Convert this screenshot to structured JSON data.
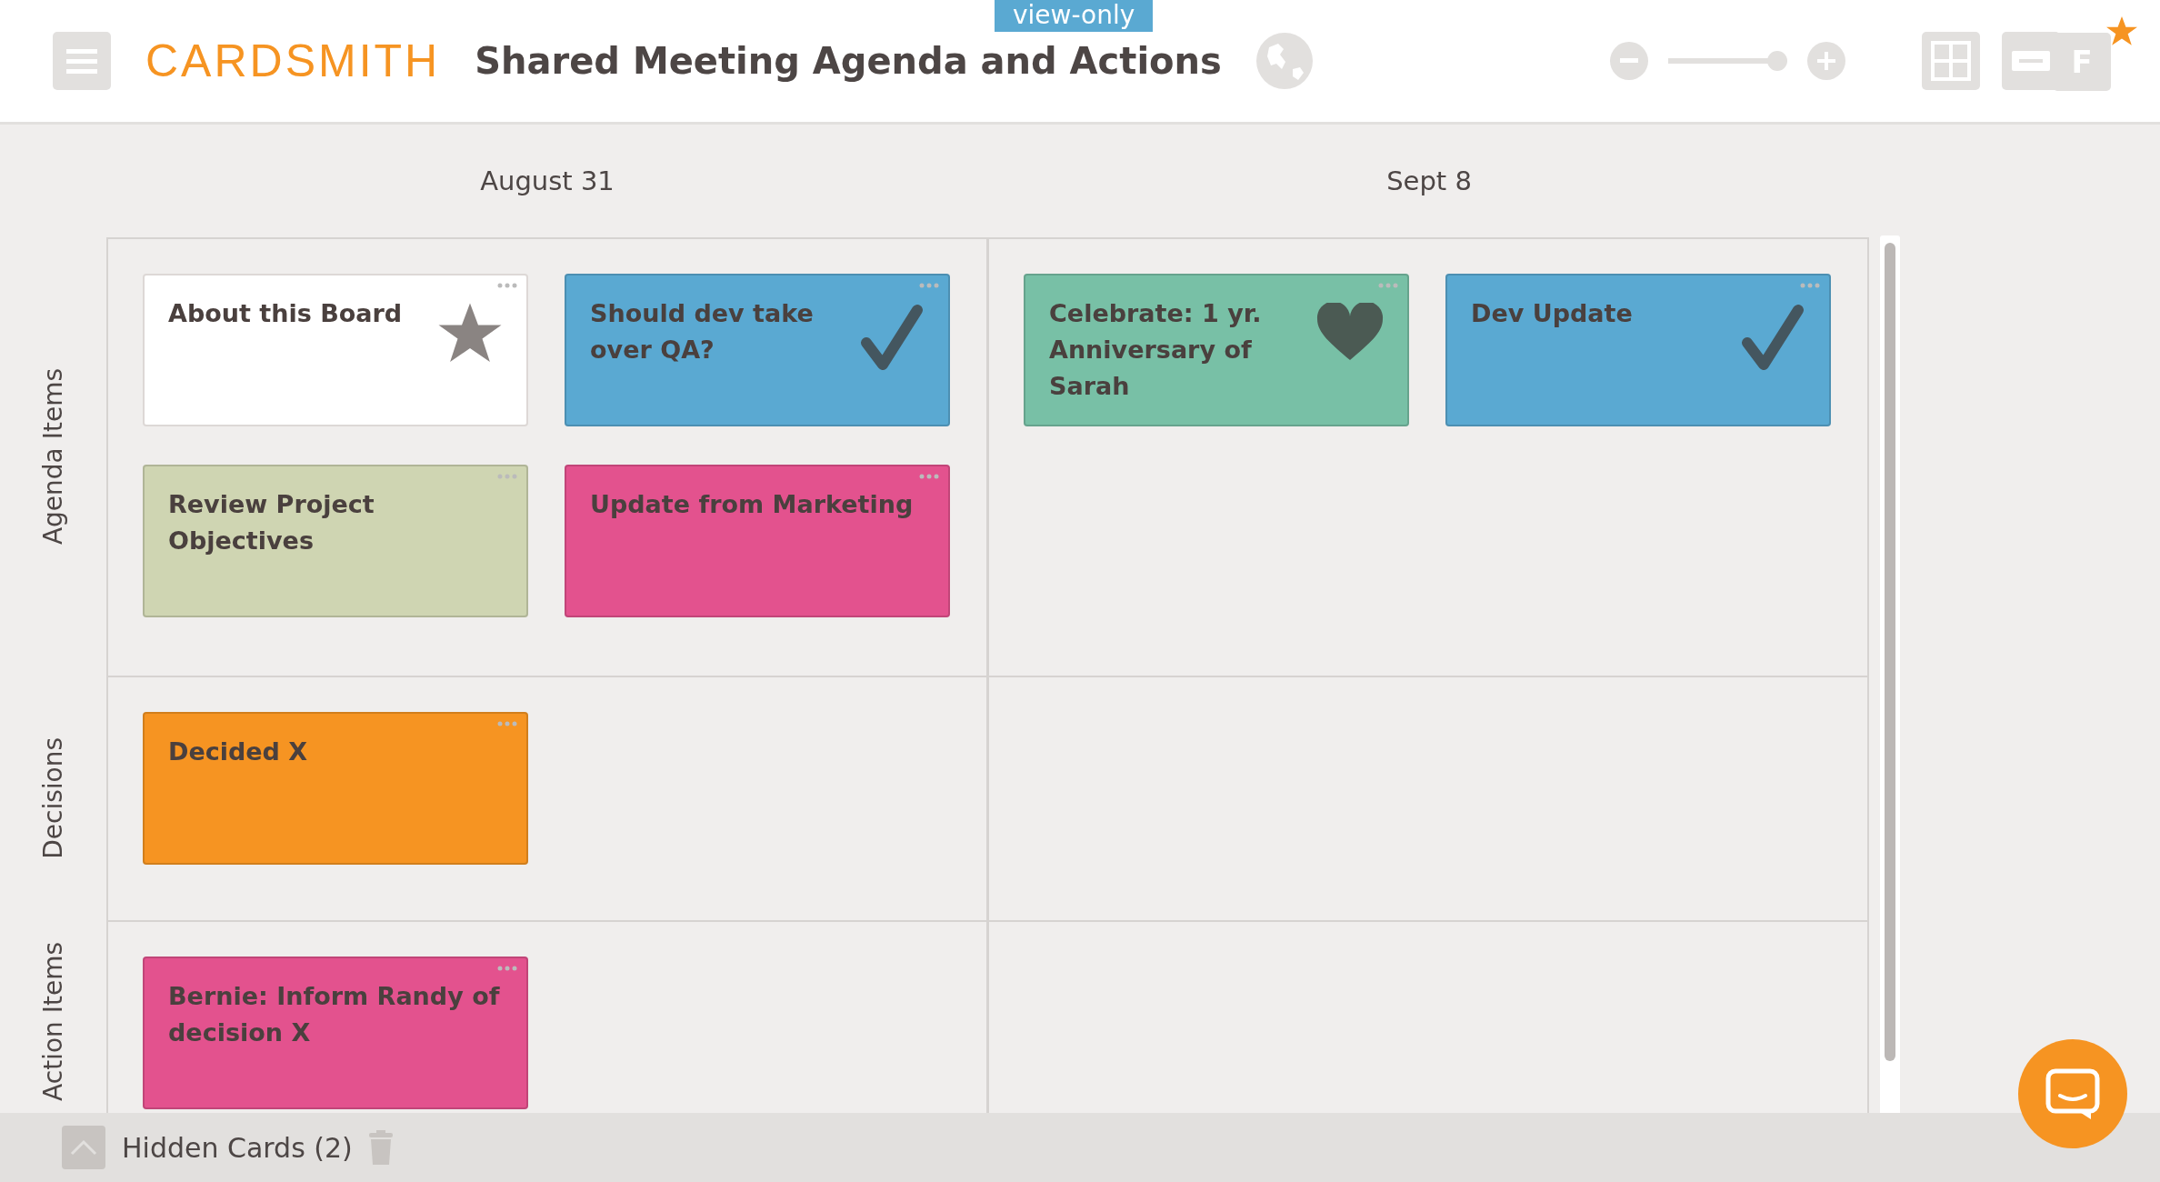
{
  "header": {
    "logo": "CARDSMITH",
    "title": "Shared Meeting Agenda and Actions",
    "badge": "view-only",
    "zoom": {
      "level": 1
    },
    "avatar": "F"
  },
  "columns": [
    "August 31",
    "Sept 8"
  ],
  "lanes": [
    {
      "label": "Agenda Items",
      "cells": [
        [
          {
            "title": "About this Board",
            "color": "#ffffff",
            "kind": "star"
          },
          {
            "title": "Should dev take over QA?",
            "color": "#5aa9d2",
            "kind": "check"
          },
          {
            "title": "Review Project Objectives",
            "color": "#cfd5b2",
            "kind": "plain"
          },
          {
            "title": "Update from Marketing",
            "color": "#e3528e",
            "kind": "plain"
          }
        ],
        [
          {
            "title": "Celebrate: 1 yr. Anniversary of Sarah",
            "color": "#78c0a6",
            "kind": "heart"
          },
          {
            "title": "Dev Update",
            "color": "#5aa9d2",
            "kind": "check"
          }
        ]
      ]
    },
    {
      "label": "Decisions",
      "cells": [
        [
          {
            "title": "Decided X",
            "color": "#f69422",
            "kind": "plain"
          }
        ],
        []
      ]
    },
    {
      "label": "Action Items",
      "cells": [
        [
          {
            "title": "Bernie: Inform Randy of decision X",
            "color": "#e3528e",
            "kind": "plain"
          }
        ],
        []
      ]
    }
  ],
  "footer": {
    "hidden_cards": "Hidden Cards (2)"
  }
}
